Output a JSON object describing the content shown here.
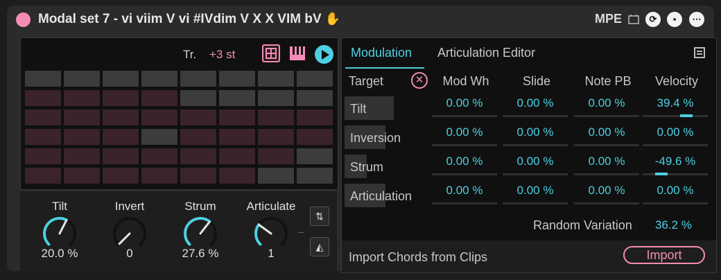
{
  "device": {
    "title": "Modal set 7 - vi viim V vi #IVdim V X X VIM bV",
    "hand_icon": "hand-icon",
    "mpe_label": "MPE",
    "icons": [
      "calendar-icon",
      "refresh-icon",
      "save-icon",
      "more-icon"
    ],
    "colors": {
      "accent_pink": "#f48cb5",
      "accent_cyan": "#4dd0e1"
    }
  },
  "pad_panel": {
    "transpose_label": "Tr.",
    "transpose_value": "+3 st",
    "pad_grid": [
      [
        "g",
        "g",
        "g",
        "g",
        "g",
        "g",
        "g",
        "g"
      ],
      [
        "r",
        "r",
        "r",
        "r",
        "g",
        "g",
        "g",
        "g"
      ],
      [
        "r",
        "r",
        "r",
        "r",
        "r",
        "r",
        "r",
        "r"
      ],
      [
        "r",
        "r",
        "r",
        "g",
        "r",
        "r",
        "r",
        "r"
      ],
      [
        "r",
        "r",
        "r",
        "r",
        "r",
        "r",
        "r",
        "g"
      ],
      [
        "r",
        "r",
        "r",
        "r",
        "r",
        "r",
        "g",
        "g"
      ]
    ]
  },
  "knobs": [
    {
      "label": "Tilt",
      "value": "20.0 %",
      "fraction": 0.6
    },
    {
      "label": "Invert",
      "value": "0",
      "fraction": 0.0
    },
    {
      "label": "Strum",
      "value": "27.6 %",
      "fraction": 0.64
    },
    {
      "label": "Articulate",
      "value": "1",
      "fraction": 0.3
    }
  ],
  "modulation": {
    "tabs": [
      "Modulation",
      "Articulation Editor"
    ],
    "target_label": "Target",
    "columns": [
      "Mod Wh",
      "Slide",
      "Note PB",
      "Velocity"
    ],
    "rows": [
      {
        "label": "Tilt",
        "level": 0.6,
        "values": [
          "0.00 %",
          "0.00 %",
          "0.00 %",
          "39.4 %"
        ],
        "velocity_amount": 0.394
      },
      {
        "label": "Inversion",
        "level": 0.5,
        "values": [
          "0.00 %",
          "0.00 %",
          "0.00 %",
          "0.00 %"
        ],
        "velocity_amount": 0.0
      },
      {
        "label": "Strum",
        "level": 0.27,
        "values": [
          "0.00 %",
          "0.00 %",
          "0.00 %",
          "-49.6 %"
        ],
        "velocity_amount": -0.496
      },
      {
        "label": "Articulation",
        "level": 0.5,
        "values": [
          "0.00 %",
          "0.00 %",
          "0.00 %",
          "0.00 %"
        ],
        "velocity_amount": 0.0
      }
    ],
    "random_variation_label": "Random Variation",
    "random_variation_value": "36.2 %",
    "import_label": "Import Chords from Clips",
    "import_button": "Import"
  }
}
